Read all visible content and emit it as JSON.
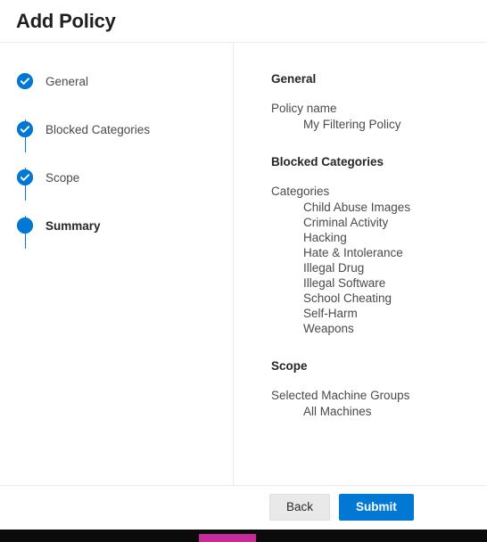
{
  "dialog": {
    "title": "Add Policy"
  },
  "stepper": {
    "steps": [
      {
        "label": "General",
        "state": "completed",
        "icon": "check-icon"
      },
      {
        "label": "Blocked Categories",
        "state": "completed",
        "icon": "check-icon"
      },
      {
        "label": "Scope",
        "state": "completed",
        "icon": "check-icon"
      },
      {
        "label": "Summary",
        "state": "current",
        "icon": "dot-icon"
      }
    ]
  },
  "summary": {
    "sections": [
      {
        "title": "General",
        "field_label": "Policy name",
        "values": [
          "My Filtering Policy"
        ]
      },
      {
        "title": "Blocked Categories",
        "field_label": "Categories",
        "values": [
          "Child Abuse Images",
          "Criminal Activity",
          "Hacking",
          "Hate & Intolerance",
          "Illegal Drug",
          "Illegal Software",
          "School Cheating",
          "Self-Harm",
          "Weapons"
        ]
      },
      {
        "title": "Scope",
        "field_label": "Selected Machine Groups",
        "values": [
          "All Machines"
        ]
      }
    ]
  },
  "footer": {
    "back_label": "Back",
    "submit_label": "Submit"
  },
  "colors": {
    "accent": "#0078d4",
    "text": "#4a4a4a",
    "heading": "#262626",
    "divider": "#ebebeb",
    "secondary_button": "#e9e9e9"
  }
}
